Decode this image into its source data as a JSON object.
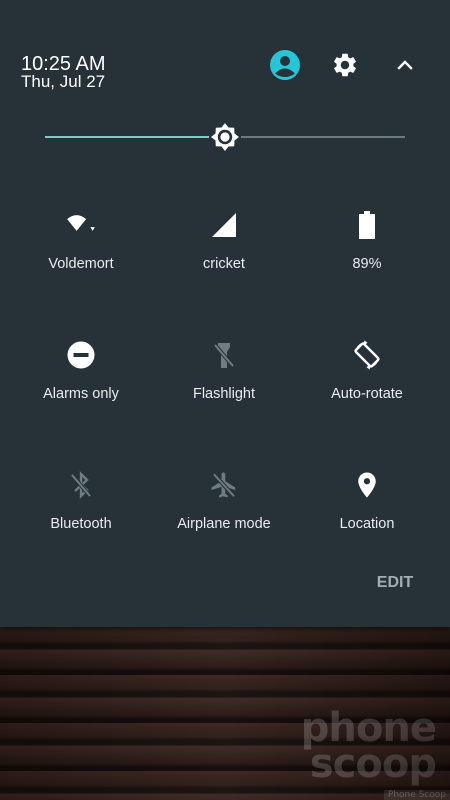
{
  "header": {
    "time": "10:25 AM",
    "date": "Thu, Jul 27",
    "user_icon": "account-circle-icon",
    "settings_icon": "gear-icon",
    "collapse_icon": "chevron-up-icon"
  },
  "brightness": {
    "level": 0.5,
    "icon": "brightness-sun-icon",
    "colors": {
      "fill": "#80cbc4",
      "track": "#6b7a80"
    }
  },
  "tiles": [
    {
      "id": "wifi",
      "label": "Voldemort",
      "icon": "wifi-icon",
      "active": true
    },
    {
      "id": "cellular",
      "label": "cricket",
      "icon": "cell-signal-icon",
      "active": true
    },
    {
      "id": "battery",
      "label": "89%",
      "icon": "battery-icon",
      "active": true
    },
    {
      "id": "dnd",
      "label": "Alarms only",
      "icon": "do-not-disturb-icon",
      "active": true
    },
    {
      "id": "flashlight",
      "label": "Flashlight",
      "icon": "flashlight-off-icon",
      "active": false
    },
    {
      "id": "rotate",
      "label": "Auto-rotate",
      "icon": "auto-rotate-icon",
      "active": true
    },
    {
      "id": "bluetooth",
      "label": "Bluetooth",
      "icon": "bluetooth-off-icon",
      "active": false
    },
    {
      "id": "airplane",
      "label": "Airplane mode",
      "icon": "airplane-off-icon",
      "active": false
    },
    {
      "id": "location",
      "label": "Location",
      "icon": "location-pin-icon",
      "active": true
    }
  ],
  "footer": {
    "edit_label": "EDIT"
  },
  "watermark": {
    "line1": "phone",
    "line2": "scoop",
    "source": "Phone Scoop"
  },
  "colors": {
    "panel": "#263238",
    "accent": "#26c6da",
    "active_icon": "#ffffff",
    "inactive_icon": "#6f7c82"
  }
}
